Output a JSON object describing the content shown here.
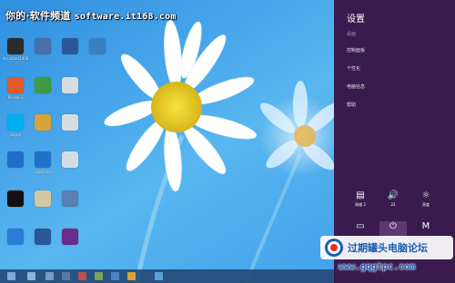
{
  "watermark": {
    "site_cn": "你的·软件频道",
    "site_url": "software.it168.com"
  },
  "desktop_icons": [
    {
      "name": "assistant",
      "label": "Assistant2008",
      "color": "#2b2b2b",
      "icon": "dragon-icon"
    },
    {
      "name": "computer",
      "label": "",
      "color": "#4b6fa8",
      "icon": "computer-icon"
    },
    {
      "name": "word-doc",
      "label": "",
      "color": "#2b5797",
      "icon": "word-icon"
    },
    {
      "name": "network",
      "label": "",
      "color": "#3c7fc0",
      "icon": "network-icon"
    },
    {
      "name": "picasa",
      "label": "Picasa 3",
      "color": "#e05a2a",
      "icon": "picasa-icon"
    },
    {
      "name": "recycle",
      "label": "",
      "color": "#3f9b43",
      "icon": "recycle-icon"
    },
    {
      "name": "file",
      "label": "",
      "color": "#d8dce2",
      "icon": "file-icon"
    },
    {
      "name": "skype",
      "label": "Skype",
      "color": "#00aff0",
      "icon": "skype-icon"
    },
    {
      "name": "tool",
      "label": "",
      "color": "#d8a23a",
      "icon": "tool-icon"
    },
    {
      "name": "file-2",
      "label": "",
      "color": "#d8dce2",
      "icon": "file-icon"
    },
    {
      "name": "sogou",
      "label": "",
      "color": "#1f6fc9",
      "icon": "sogou-icon"
    },
    {
      "name": "skydrive",
      "label": "SkyDrive",
      "color": "#1f72c9",
      "icon": "cloud-icon"
    },
    {
      "name": "file-3",
      "label": "",
      "color": "#d8dce2",
      "icon": "file-icon"
    },
    {
      "name": "qq",
      "label": "",
      "color": "#111111",
      "icon": "qq-icon"
    },
    {
      "name": "folder",
      "label": "",
      "color": "#d2c7a0",
      "icon": "folder-icon"
    },
    {
      "name": "window",
      "label": "",
      "color": "#5a7fb0",
      "icon": "window-icon"
    },
    {
      "name": "ie",
      "label": "",
      "color": "#2a7cd8",
      "icon": "ie-icon"
    },
    {
      "name": "word-2",
      "label": "",
      "color": "#2b5797",
      "icon": "word-icon"
    },
    {
      "name": "media",
      "label": "",
      "color": "#6b2b8a",
      "icon": "media-icon"
    }
  ],
  "charms": {
    "title": "设置",
    "subtitle": "桌面",
    "items": [
      "控制面板",
      "个性化",
      "电脑信息",
      "帮助"
    ],
    "quick_settings": [
      {
        "name": "network",
        "label": "网络 2",
        "icon": "network-icon",
        "glyph": "▤"
      },
      {
        "name": "volume",
        "label": "22",
        "icon": "volume-icon",
        "glyph": "🔊"
      },
      {
        "name": "brightness",
        "label": "亮度",
        "icon": "brightness-icon",
        "glyph": "☼"
      },
      {
        "name": "notifications",
        "label": "",
        "icon": "notifications-icon",
        "glyph": "▭"
      },
      {
        "name": "power",
        "label": "",
        "icon": "power-icon",
        "glyph": "⏻"
      },
      {
        "name": "keyboard",
        "label": "",
        "icon": "keyboard-icon",
        "glyph": "M"
      }
    ]
  },
  "brand": {
    "name": "过期罐头电脑论坛",
    "url": "www.gqgtpc.com"
  },
  "taskbar": {
    "buttons": [
      {
        "name": "start",
        "color": "#7fa8d8"
      },
      {
        "name": "explorer",
        "color": "#8fb3d9"
      },
      {
        "name": "app-1",
        "color": "#7a9bc4"
      },
      {
        "name": "app-2",
        "color": "#5b79a8"
      },
      {
        "name": "app-3",
        "color": "#c0504d"
      },
      {
        "name": "app-4",
        "color": "#7aa55a"
      },
      {
        "name": "app-5",
        "color": "#4a85c8"
      },
      {
        "name": "app-6",
        "color": "#d8a23a"
      },
      {
        "name": "app-7",
        "color": "#5aa0d8"
      }
    ]
  },
  "colors": {
    "charms_bg": "#3a1b4f",
    "wallpaper_sky": "#4aa8e8",
    "brand_blue": "#1a5fb4"
  }
}
